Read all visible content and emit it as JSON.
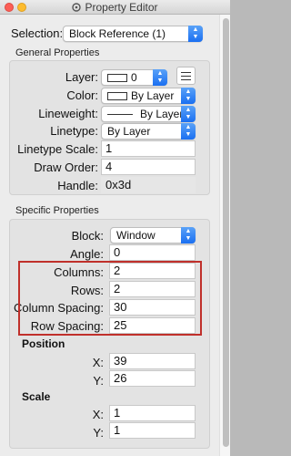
{
  "window": {
    "title": "Property Editor"
  },
  "selection": {
    "label": "Selection:",
    "value": "Block Reference (1)"
  },
  "general": {
    "title": "General Properties",
    "layer": {
      "label": "Layer:",
      "value": "0"
    },
    "color": {
      "label": "Color:",
      "value": "By Layer"
    },
    "lineweight": {
      "label": "Lineweight:",
      "value": "By Layer"
    },
    "linetype": {
      "label": "Linetype:",
      "value": "By Layer"
    },
    "linetype_scale": {
      "label": "Linetype Scale:",
      "value": "1"
    },
    "draw_order": {
      "label": "Draw Order:",
      "value": "4"
    },
    "handle": {
      "label": "Handle:",
      "value": "0x3d"
    }
  },
  "specific": {
    "title": "Specific Properties",
    "block": {
      "label": "Block:",
      "value": "Window"
    },
    "angle": {
      "label": "Angle:",
      "value": "0"
    },
    "columns": {
      "label": "Columns:",
      "value": "2"
    },
    "rows": {
      "label": "Rows:",
      "value": "2"
    },
    "column_spacing": {
      "label": "Column Spacing:",
      "value": "30"
    },
    "row_spacing": {
      "label": "Row Spacing:",
      "value": "25"
    },
    "position": {
      "title": "Position",
      "x": {
        "label": "X:",
        "value": "39"
      },
      "y": {
        "label": "Y:",
        "value": "26"
      }
    },
    "scale": {
      "title": "Scale",
      "x": {
        "label": "X:",
        "value": "1"
      },
      "y": {
        "label": "Y:",
        "value": "1"
      }
    }
  },
  "colors": {
    "accent": "#1a6ff1",
    "highlight": "#c0302b"
  }
}
